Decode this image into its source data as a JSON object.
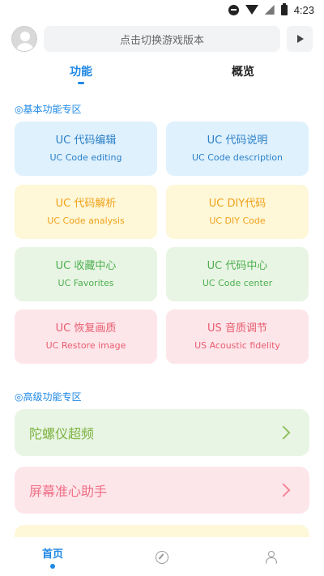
{
  "status_bar": {
    "time": "4:23"
  },
  "header": {
    "search_text": "点击切换游戏版本"
  },
  "tabs": [
    {
      "label": "功能",
      "active": true
    },
    {
      "label": "概览",
      "active": false
    }
  ],
  "sections": {
    "basic_title": "◎基本功能专区",
    "advanced_title": "◎高级功能专区"
  },
  "basic_cards": [
    {
      "title": "UC 代码编辑",
      "subtitle": "UC Code editing",
      "color": "#2a7fc7"
    },
    {
      "title": "UC 代码说明",
      "subtitle": "UC Code description",
      "color": "#2a7fc7"
    },
    {
      "title": "UC 代码解析",
      "subtitle": "UC Code analysis",
      "color": "#f0a21a"
    },
    {
      "title": "UC DIY代码",
      "subtitle": "UC DIY Code",
      "color": "#f0a21a"
    },
    {
      "title": "UC 收藏中心",
      "subtitle": "UC Favorites",
      "color": "#4caf50"
    },
    {
      "title": "UC 代码中心",
      "subtitle": "UC Code center",
      "color": "#4caf50"
    },
    {
      "title": "UC 恢复画质",
      "subtitle": "UC Restore image",
      "color": "#e85c6f"
    },
    {
      "title": "US 音质调节",
      "subtitle": "US Acoustic fidelity",
      "color": "#e85c6f"
    }
  ],
  "advanced_items": [
    {
      "label": "陀螺仪超频",
      "color": "#7cb342"
    },
    {
      "label": "屏幕准心助手",
      "color": "#ef6f86"
    }
  ],
  "bottom_nav": {
    "home_label": "首页",
    "icons": [
      "compass-icon",
      "user-icon"
    ]
  },
  "colors": {
    "accent": "#1e88e5"
  }
}
